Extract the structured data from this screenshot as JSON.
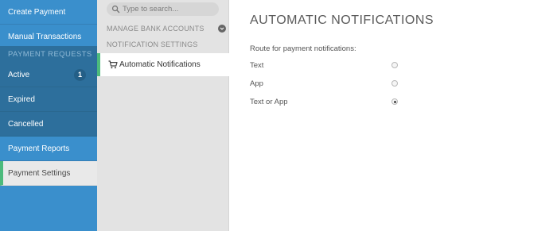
{
  "sidebar": {
    "items": [
      {
        "label": "Create Payment Request"
      },
      {
        "label": "Manual Transactions"
      },
      {
        "label": "PAYMENT REQUESTS"
      },
      {
        "label": "Active",
        "badge": "1"
      },
      {
        "label": "Expired"
      },
      {
        "label": "Cancelled"
      },
      {
        "label": "Payment Reports"
      },
      {
        "label": "Payment Settings"
      }
    ]
  },
  "settings_nav": {
    "search_placeholder": "Type to search...",
    "manage_bank_accounts": "MANAGE BANK ACCOUNTS",
    "notification_settings": "NOTIFICATION SETTINGS",
    "selected_item": "Automatic Notifications"
  },
  "main": {
    "title": "AUTOMATIC NOTIFICATIONS",
    "route_label": "Route for payment notifications:",
    "options": [
      {
        "label": "Text",
        "selected": false
      },
      {
        "label": "App",
        "selected": false
      },
      {
        "label": "Text or App",
        "selected": true
      }
    ]
  },
  "colors": {
    "nav_blue": "#3a8fcc",
    "nav_dark": "#2d6f9c",
    "accent_green": "#4cba7c"
  },
  "icons": [
    "search-icon",
    "chevron-down-icon",
    "cart-icon"
  ]
}
